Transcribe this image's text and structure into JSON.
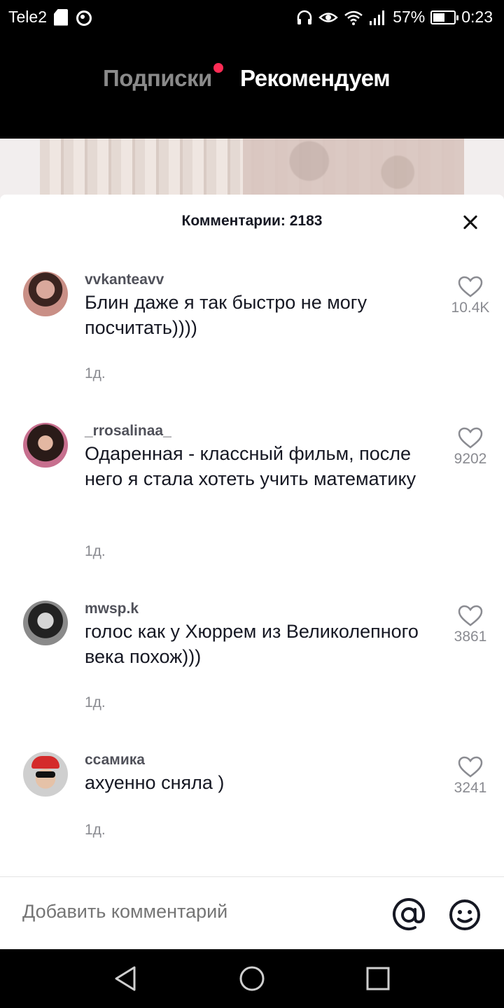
{
  "status_bar": {
    "carrier": "Tele2",
    "battery": "57%",
    "battery_level": 0.57,
    "time": "0:23"
  },
  "top_nav": {
    "tab_following": "Подписки",
    "tab_for_you": "Рекомендуем",
    "notification_dot_color": "#fe2c55"
  },
  "comments": {
    "title": "Комментарии: 2183",
    "items": [
      {
        "username": "vvkanteavv",
        "text": "Блин даже я так быстро не могу посчитать))))",
        "date": "1д.",
        "likes": "10.4K"
      },
      {
        "username": "_rrosalinaa_",
        "text": "Одаренная - классный фильм, после него я стала хотеть учить математику",
        "date": "1д.",
        "likes": "9202"
      },
      {
        "username": "mwsp.k",
        "text": "голос как у Хюррем из Великолепного века похож)))",
        "date": "1д.",
        "likes": "3861"
      },
      {
        "username": "ссамика",
        "text": "ахуенно сняла )",
        "date": "1д.",
        "likes": "3241"
      }
    ]
  },
  "add_comment": {
    "placeholder": "Добавить комментарий",
    "mention_icon": "at-sign-icon",
    "emoji_icon": "smiley-icon"
  },
  "nav_bar": {
    "back_icon": "back-triangle-icon",
    "home_icon": "home-circle-icon",
    "recent_icon": "recent-square-icon"
  }
}
